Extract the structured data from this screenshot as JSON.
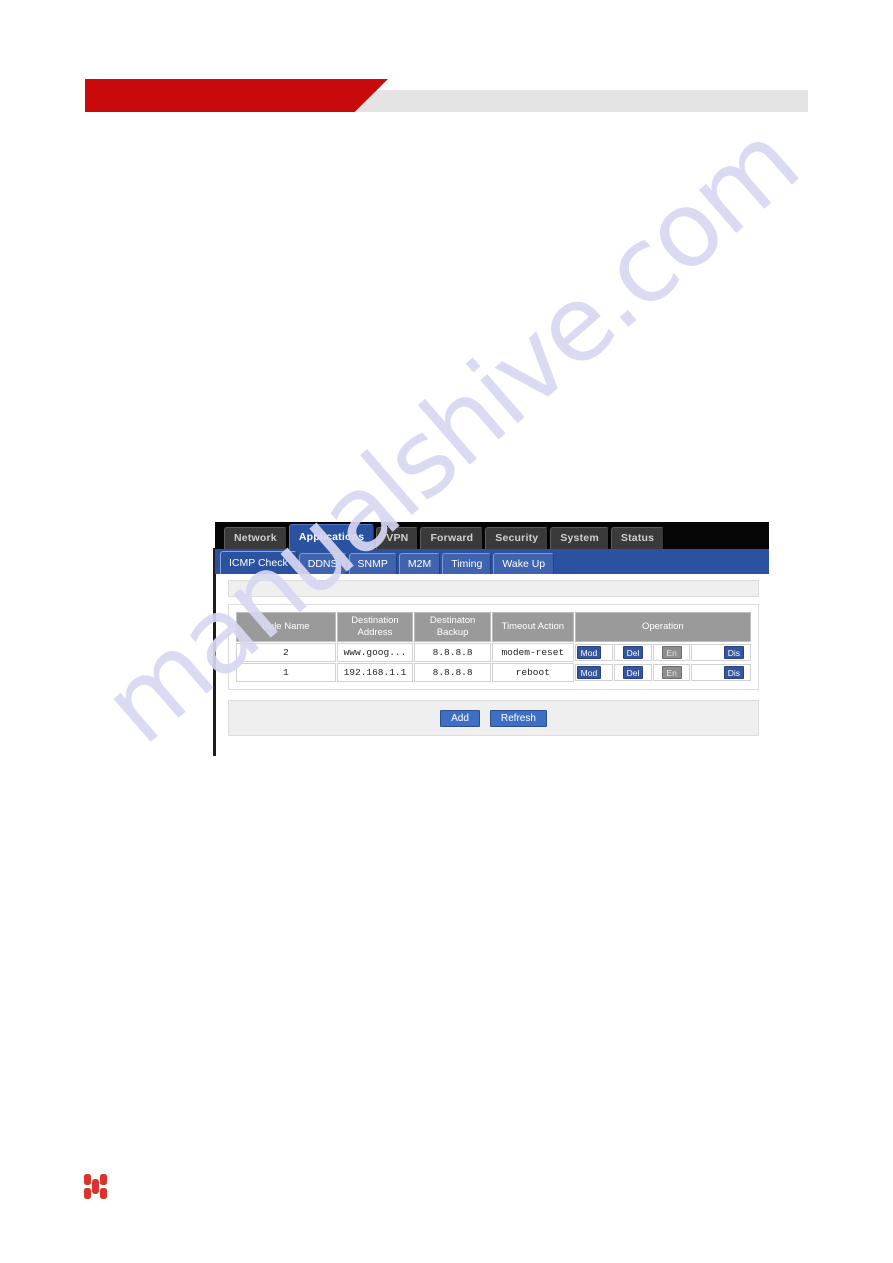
{
  "header": {
    "brand_shape": "red-angled-banner",
    "accent_color": "#c80a0a",
    "bar_color": "#e4e4e4"
  },
  "watermark": {
    "text": "manualshive.com",
    "color": "#d8d7f2"
  },
  "router_ui": {
    "main_nav": {
      "items": [
        {
          "label": "Network",
          "active": false
        },
        {
          "label": "Applications",
          "active": true
        },
        {
          "label": "VPN",
          "active": false
        },
        {
          "label": "Forward",
          "active": false
        },
        {
          "label": "Security",
          "active": false
        },
        {
          "label": "System",
          "active": false
        },
        {
          "label": "Status",
          "active": false
        }
      ]
    },
    "sub_nav": {
      "items": [
        {
          "label": "ICMP Check",
          "active": true
        },
        {
          "label": "DDNS",
          "active": false
        },
        {
          "label": "SNMP",
          "active": false
        },
        {
          "label": "M2M",
          "active": false
        },
        {
          "label": "Timing",
          "active": false
        },
        {
          "label": "Wake Up",
          "active": false
        }
      ]
    },
    "table": {
      "headers": [
        "Rule Name",
        "Destination Address",
        "Destinaton Backup",
        "Timeout Action",
        "Operation"
      ],
      "rows": [
        {
          "rule_name": "2",
          "destination_address": "www.goog...",
          "destination_backup": "8.8.8.8",
          "timeout_action": "modem-reset",
          "operations": [
            {
              "label": "Mod",
              "disabled": false
            },
            {
              "label": "Del",
              "disabled": false
            },
            {
              "label": "En",
              "disabled": true
            },
            {
              "label": "Dis",
              "disabled": false
            }
          ]
        },
        {
          "rule_name": "1",
          "destination_address": "192.168.1.1",
          "destination_backup": "8.8.8.8",
          "timeout_action": "reboot",
          "operations": [
            {
              "label": "Mod",
              "disabled": false
            },
            {
              "label": "Del",
              "disabled": false
            },
            {
              "label": "En",
              "disabled": true
            },
            {
              "label": "Dis",
              "disabled": false
            }
          ]
        }
      ]
    },
    "actions": {
      "add_label": "Add",
      "refresh_label": "Refresh"
    },
    "colors": {
      "nav_bar": "#050505",
      "sub_nav_bar": "#2a52a0",
      "button_blue": "#3f6fc4",
      "header_gray": "#9a9a9a",
      "disabled_gray": "#8e8e8e"
    }
  },
  "footer": {
    "logo_name": "h-mark-logo",
    "logo_color": "#d8342b"
  }
}
